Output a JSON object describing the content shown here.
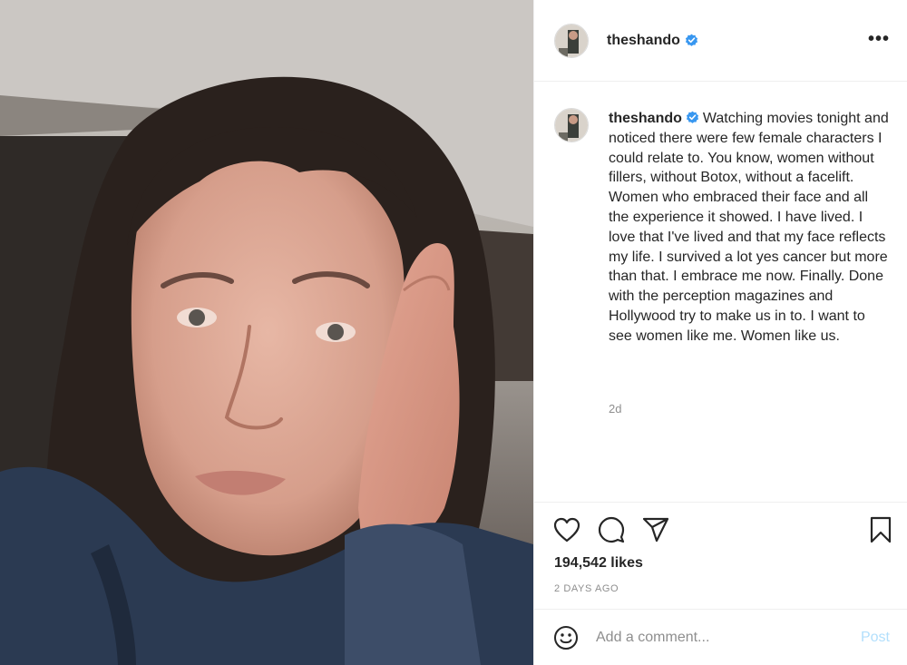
{
  "photo": {
    "alt": "selfie-photo"
  },
  "header": {
    "username": "theshando",
    "verified_icon": "verified-badge-icon",
    "more_icon": "more-options-icon",
    "more_label": "•••"
  },
  "caption": {
    "username": "theshando",
    "text": "Watching movies tonight and noticed there were few female characters I could relate to. You know, women without fillers, without Botox, without a facelift. Women who embraced their face and all the experience it showed. I have lived. I love that I've lived and that my face reflects my life. I survived a lot yes cancer but more than that. I embrace me now. Finally. Done with the perception magazines and Hollywood try to make us in to. I want to see women like me. Women like us.",
    "time_ago": "2d"
  },
  "actions": {
    "icons": [
      "heart-icon",
      "comment-icon",
      "share-icon",
      "bookmark-icon"
    ],
    "likes": "194,542 likes",
    "date": "2 DAYS AGO"
  },
  "comment": {
    "emoji_icon": "emoji-icon",
    "placeholder": "Add a comment...",
    "post_label": "Post"
  },
  "colors": {
    "text": "#262626",
    "muted": "#8e8e8e",
    "verified": "#3897f0",
    "post_disabled": "#b2dffc",
    "border": "#efefef"
  }
}
